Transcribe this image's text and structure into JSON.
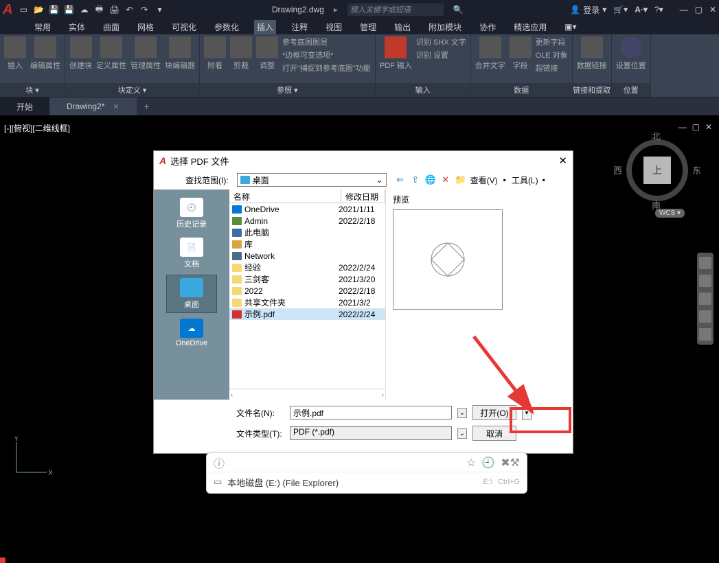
{
  "titlebar": {
    "filename": "Drawing2.dwg",
    "search_placeholder": "键入关键字或短语",
    "login": "登录"
  },
  "menubar": {
    "items": [
      "常用",
      "实体",
      "曲面",
      "网格",
      "可视化",
      "参数化",
      "插入",
      "注释",
      "视图",
      "管理",
      "输出",
      "附加模块",
      "协作",
      "精选应用"
    ],
    "active_index": 6
  },
  "ribbon": {
    "panels": [
      {
        "title": "块 ▾",
        "buttons": [
          {
            "label": "插入"
          },
          {
            "label": "编辑属性"
          }
        ]
      },
      {
        "title": "块定义 ▾",
        "buttons": [
          {
            "label": "创建块"
          },
          {
            "label": "定义属性"
          },
          {
            "label": "管理属性"
          },
          {
            "label": "块编辑器"
          }
        ]
      },
      {
        "title": "参照 ▾",
        "buttons": [
          {
            "label": "附着"
          },
          {
            "label": "剪裁"
          },
          {
            "label": "调整"
          }
        ],
        "list": [
          "参考底图图层",
          "*边框可变选项*",
          "打开\"捕捉到参考底图\"功能"
        ]
      },
      {
        "title": "输入",
        "buttons": [
          {
            "label": "PDF 输入"
          }
        ],
        "list": [
          "识别 SHX 文字",
          "识别 设置"
        ]
      },
      {
        "title": "数据",
        "buttons": [
          {
            "label": "合并文字"
          },
          {
            "label": "字段"
          }
        ],
        "list": [
          "更新字段",
          "OLE 对象",
          "超链接"
        ]
      },
      {
        "title": "链接和提取",
        "buttons": [
          {
            "label": "数据链接"
          }
        ]
      },
      {
        "title": "位置",
        "buttons": [
          {
            "label": "设置位置"
          }
        ]
      }
    ]
  },
  "doc_tabs": {
    "tabs": [
      {
        "label": "开始",
        "active": false
      },
      {
        "label": "Drawing2*",
        "active": true
      }
    ]
  },
  "canvas": {
    "view_label": "[-][俯视][二维线框]",
    "viewcube": {
      "top": "上",
      "n": "北",
      "e": "东",
      "s": "南",
      "w": "西"
    },
    "wcs": "WCS ▾",
    "ucs_y": "Y",
    "ucs_x": "X"
  },
  "dialog": {
    "title": "选择 PDF 文件",
    "lookin_label": "查找范围(I):",
    "lookin_value": "桌面",
    "view_label": "查看(V)",
    "tools_label": "工具(L)",
    "sidebar": [
      {
        "label": "历史记录"
      },
      {
        "label": "文档"
      },
      {
        "label": "桌面",
        "selected": true
      },
      {
        "label": "OneDrive"
      }
    ],
    "columns": {
      "name": "名称",
      "date": "修改日期"
    },
    "files": [
      {
        "icon": "cloud",
        "name": "OneDrive",
        "date": "2021/1/11"
      },
      {
        "icon": "user",
        "name": "Admin",
        "date": "2022/2/18"
      },
      {
        "icon": "pc",
        "name": "此电脑",
        "date": ""
      },
      {
        "icon": "lib",
        "name": "库",
        "date": ""
      },
      {
        "icon": "net",
        "name": "Network",
        "date": ""
      },
      {
        "icon": "folder",
        "name": "经验",
        "date": "2022/2/24"
      },
      {
        "icon": "folder",
        "name": "三剑客",
        "date": "2021/3/20"
      },
      {
        "icon": "folder",
        "name": "2022",
        "date": "2022/2/18"
      },
      {
        "icon": "folder",
        "name": "共享文件夹",
        "date": "2021/3/2"
      },
      {
        "icon": "pdf",
        "name": "示例.pdf",
        "date": "2022/2/24",
        "selected": true
      }
    ],
    "preview_label": "预览",
    "filename_label": "文件名(N):",
    "filename_value": "示例.pdf",
    "filetype_label": "文件类型(T):",
    "filetype_value": "PDF (*.pdf)",
    "open_btn": "打开(O)",
    "cancel_btn": "取消"
  },
  "bottom": {
    "location": "本地磁盘 (E:) (File Explorer)",
    "hint_drive": "E:\\",
    "hint_key": "Ctrl+G"
  }
}
